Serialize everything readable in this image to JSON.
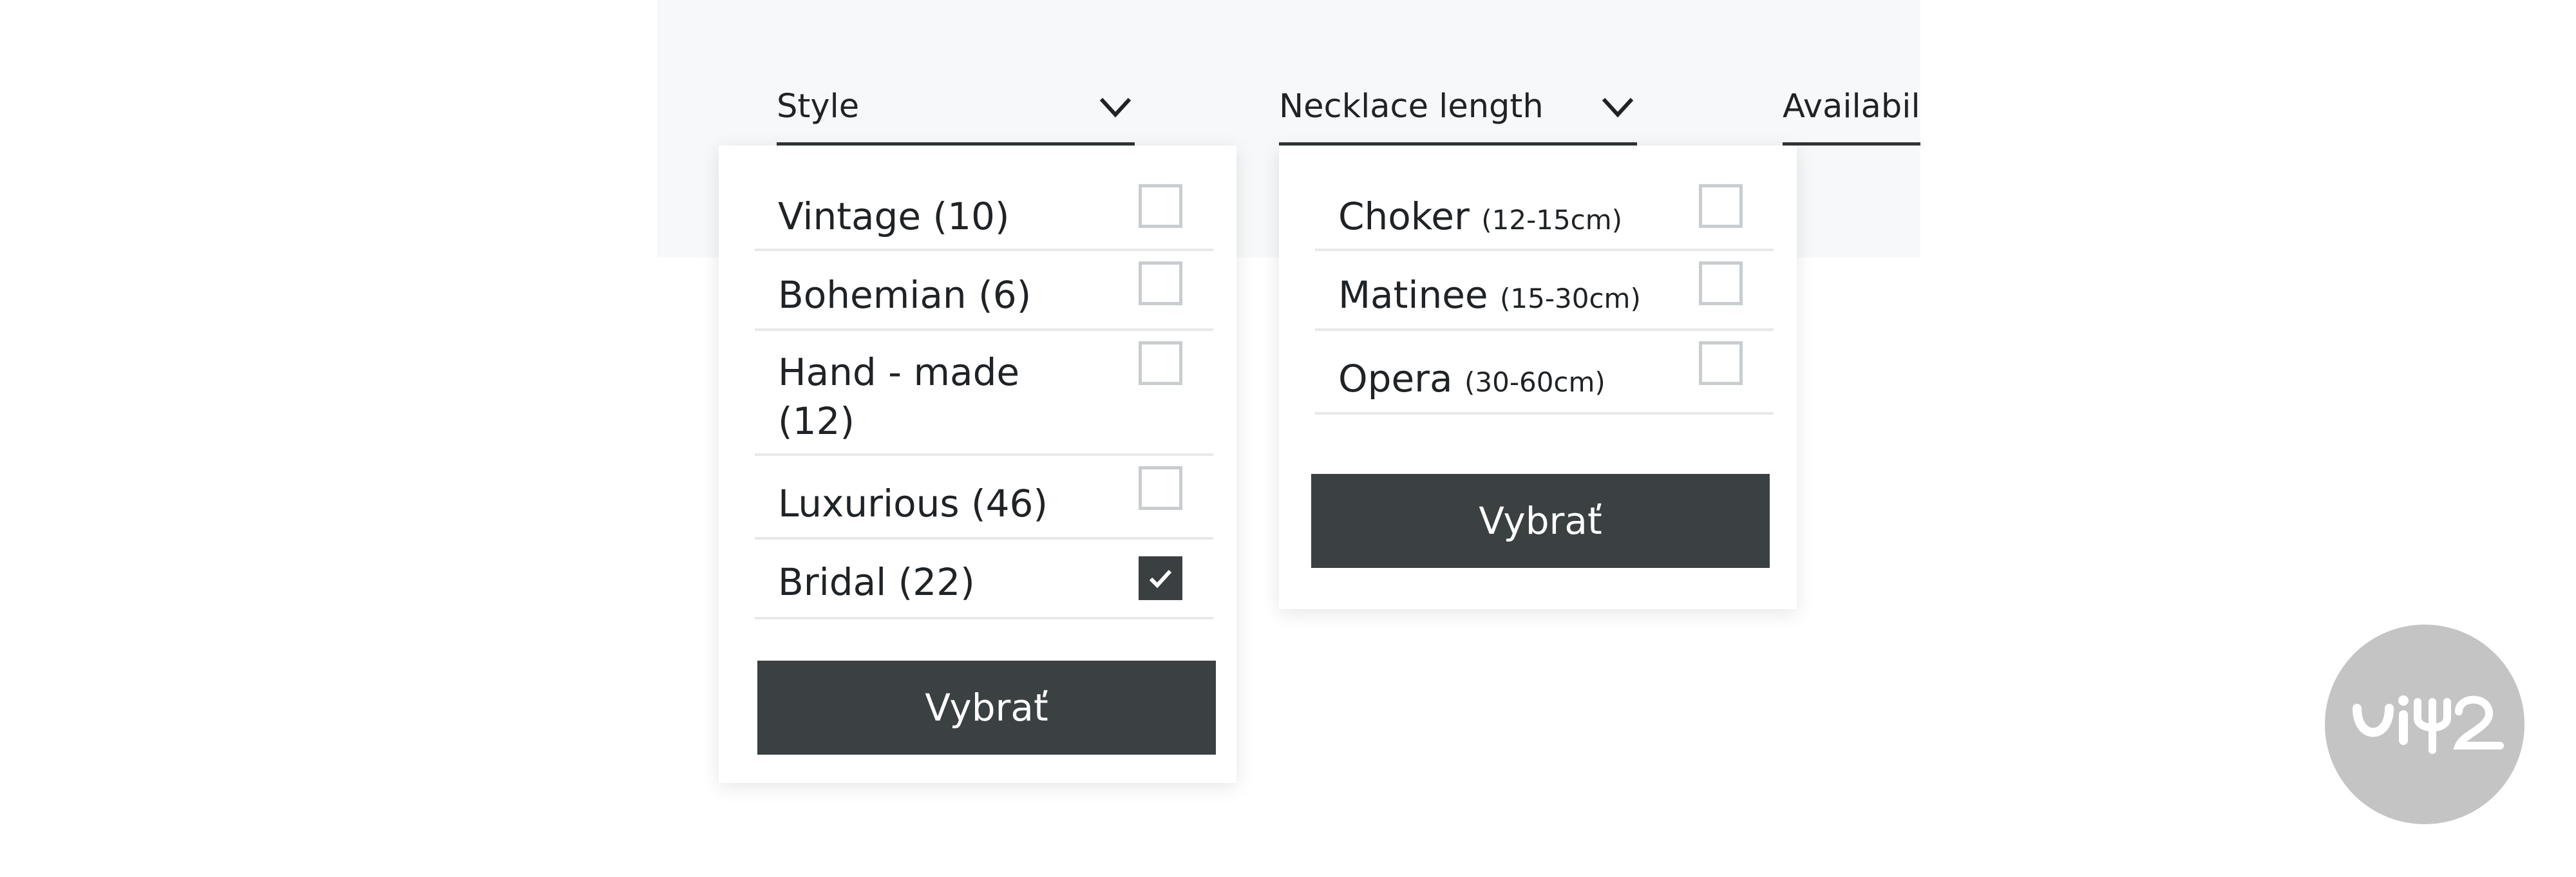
{
  "filters": {
    "style": {
      "label": "Style",
      "options": [
        {
          "name": "Vintage",
          "count": "(10)",
          "checked": false
        },
        {
          "name": "Bohemian",
          "count": "(6)",
          "checked": false
        },
        {
          "name": "Hand - made",
          "count": "(12)",
          "checked": false
        },
        {
          "name": "Luxurious",
          "count": "(46)",
          "checked": false
        },
        {
          "name": "Bridal",
          "count": "(22)",
          "checked": true
        }
      ],
      "apply_label": "Vybrať"
    },
    "necklace_length": {
      "label": "Necklace length",
      "options": [
        {
          "name": "Choker",
          "range": "(12-15cm)",
          "checked": false
        },
        {
          "name": "Matinee",
          "range": "(15-30cm)",
          "checked": false
        },
        {
          "name": "Opera",
          "range": "(30-60cm)",
          "checked": false
        }
      ],
      "apply_label": "Vybrať"
    },
    "availability": {
      "label": "Availabil"
    }
  },
  "icons": {
    "dropdown": "chevron-down-icon",
    "check": "checkmark-icon",
    "badge": "logo-badge-icon"
  },
  "colors": {
    "bar_bg": "#f7f8f9",
    "button_bg": "#3b4042",
    "checked_bg": "#3a3f41",
    "badge_bg": "#c4c4c4"
  }
}
